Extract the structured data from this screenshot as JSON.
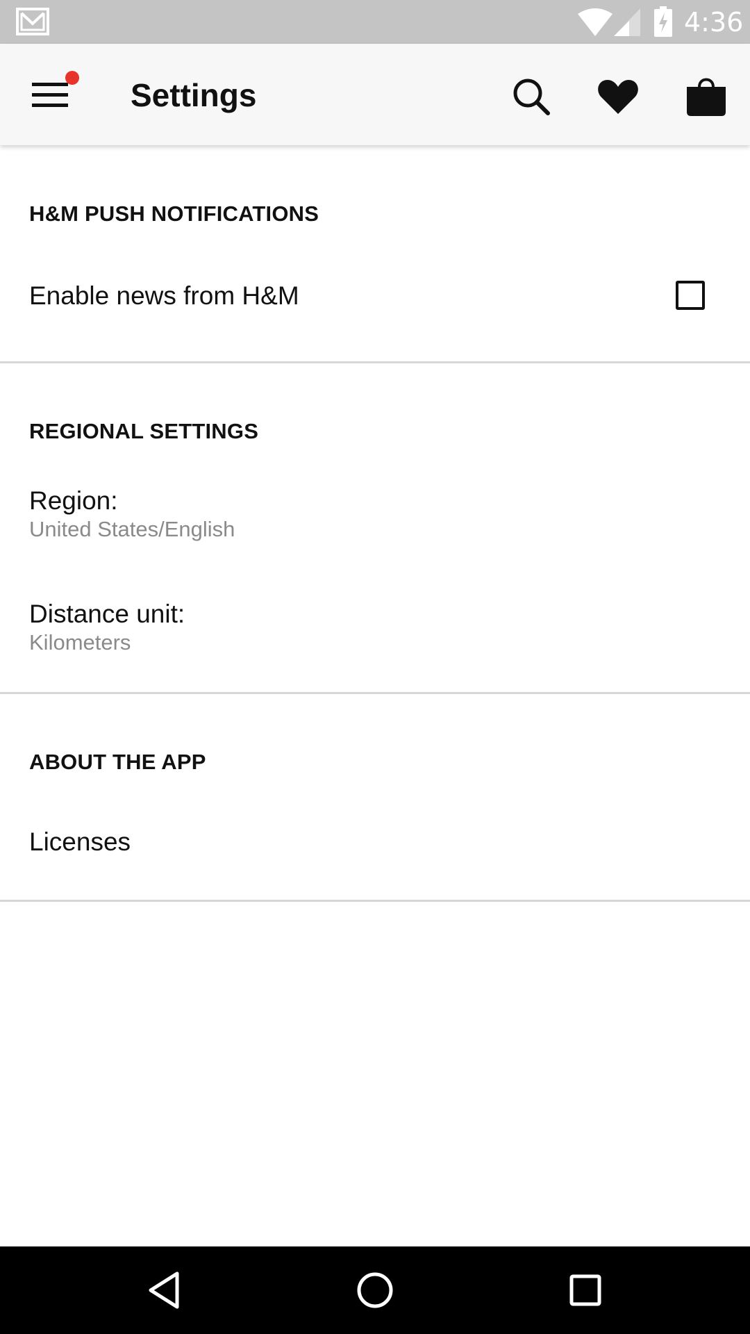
{
  "status_bar": {
    "time": "4:36",
    "icons": [
      "gmail-notification-icon",
      "wifi-icon",
      "cellular-signal-icon",
      "battery-charging-icon"
    ]
  },
  "app_bar": {
    "title": "Settings",
    "icons": [
      "menu-icon",
      "search-icon",
      "heart-icon",
      "shopping-bag-icon"
    ],
    "notification_dot_color": "#e8332a"
  },
  "sections": {
    "push": {
      "header": "H&M PUSH NOTIFICATIONS",
      "enable_news_label": "Enable news from H&M",
      "enable_news_checked": false
    },
    "regional": {
      "header": "REGIONAL SETTINGS",
      "region_label": "Region:",
      "region_value": "United States/English",
      "distance_label": "Distance unit:",
      "distance_value": "Kilometers"
    },
    "about": {
      "header": "ABOUT THE APP",
      "licenses_label": "Licenses"
    }
  },
  "nav_bar": {
    "icons": [
      "back-icon",
      "home-icon",
      "recents-icon"
    ]
  },
  "colors": {
    "status_bar": "#c4c4c4",
    "app_bar": "#f7f7f7",
    "secondary_text": "#8a8a8a",
    "divider": "#d6d6d6",
    "nav_bar": "#000000"
  }
}
